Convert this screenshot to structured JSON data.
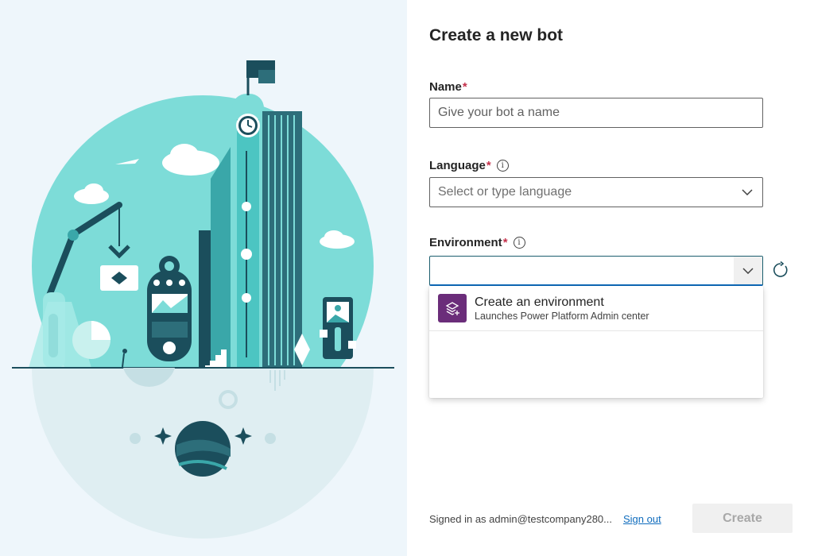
{
  "page": {
    "title": "Create a new bot"
  },
  "form": {
    "name": {
      "label": "Name",
      "required_mark": "*",
      "placeholder": "Give your bot a name",
      "value": ""
    },
    "language": {
      "label": "Language",
      "required_mark": "*",
      "info_icon": "info-icon",
      "placeholder": "Select or type language",
      "value": ""
    },
    "environment": {
      "label": "Environment",
      "required_mark": "*",
      "info_icon": "info-icon",
      "value": "",
      "refresh_icon": "refresh-icon",
      "dropdown": {
        "expanded": true,
        "items": [
          {
            "title": "Create an environment",
            "subtitle": "Launches Power Platform Admin center",
            "icon": "layers-add-icon"
          }
        ]
      }
    }
  },
  "footer": {
    "signed_in_text": "Signed in as admin@testcompany280...",
    "sign_out_label": "Sign out",
    "create_label": "Create"
  },
  "colors": {
    "required": "#c4314b",
    "link": "#0f6cbd",
    "env_icon_bg": "#6b2d7a",
    "illustration_teal": "#5fd3cf",
    "illustration_dark": "#1b4e5c",
    "left_panel_bg": "#eef6fb"
  }
}
